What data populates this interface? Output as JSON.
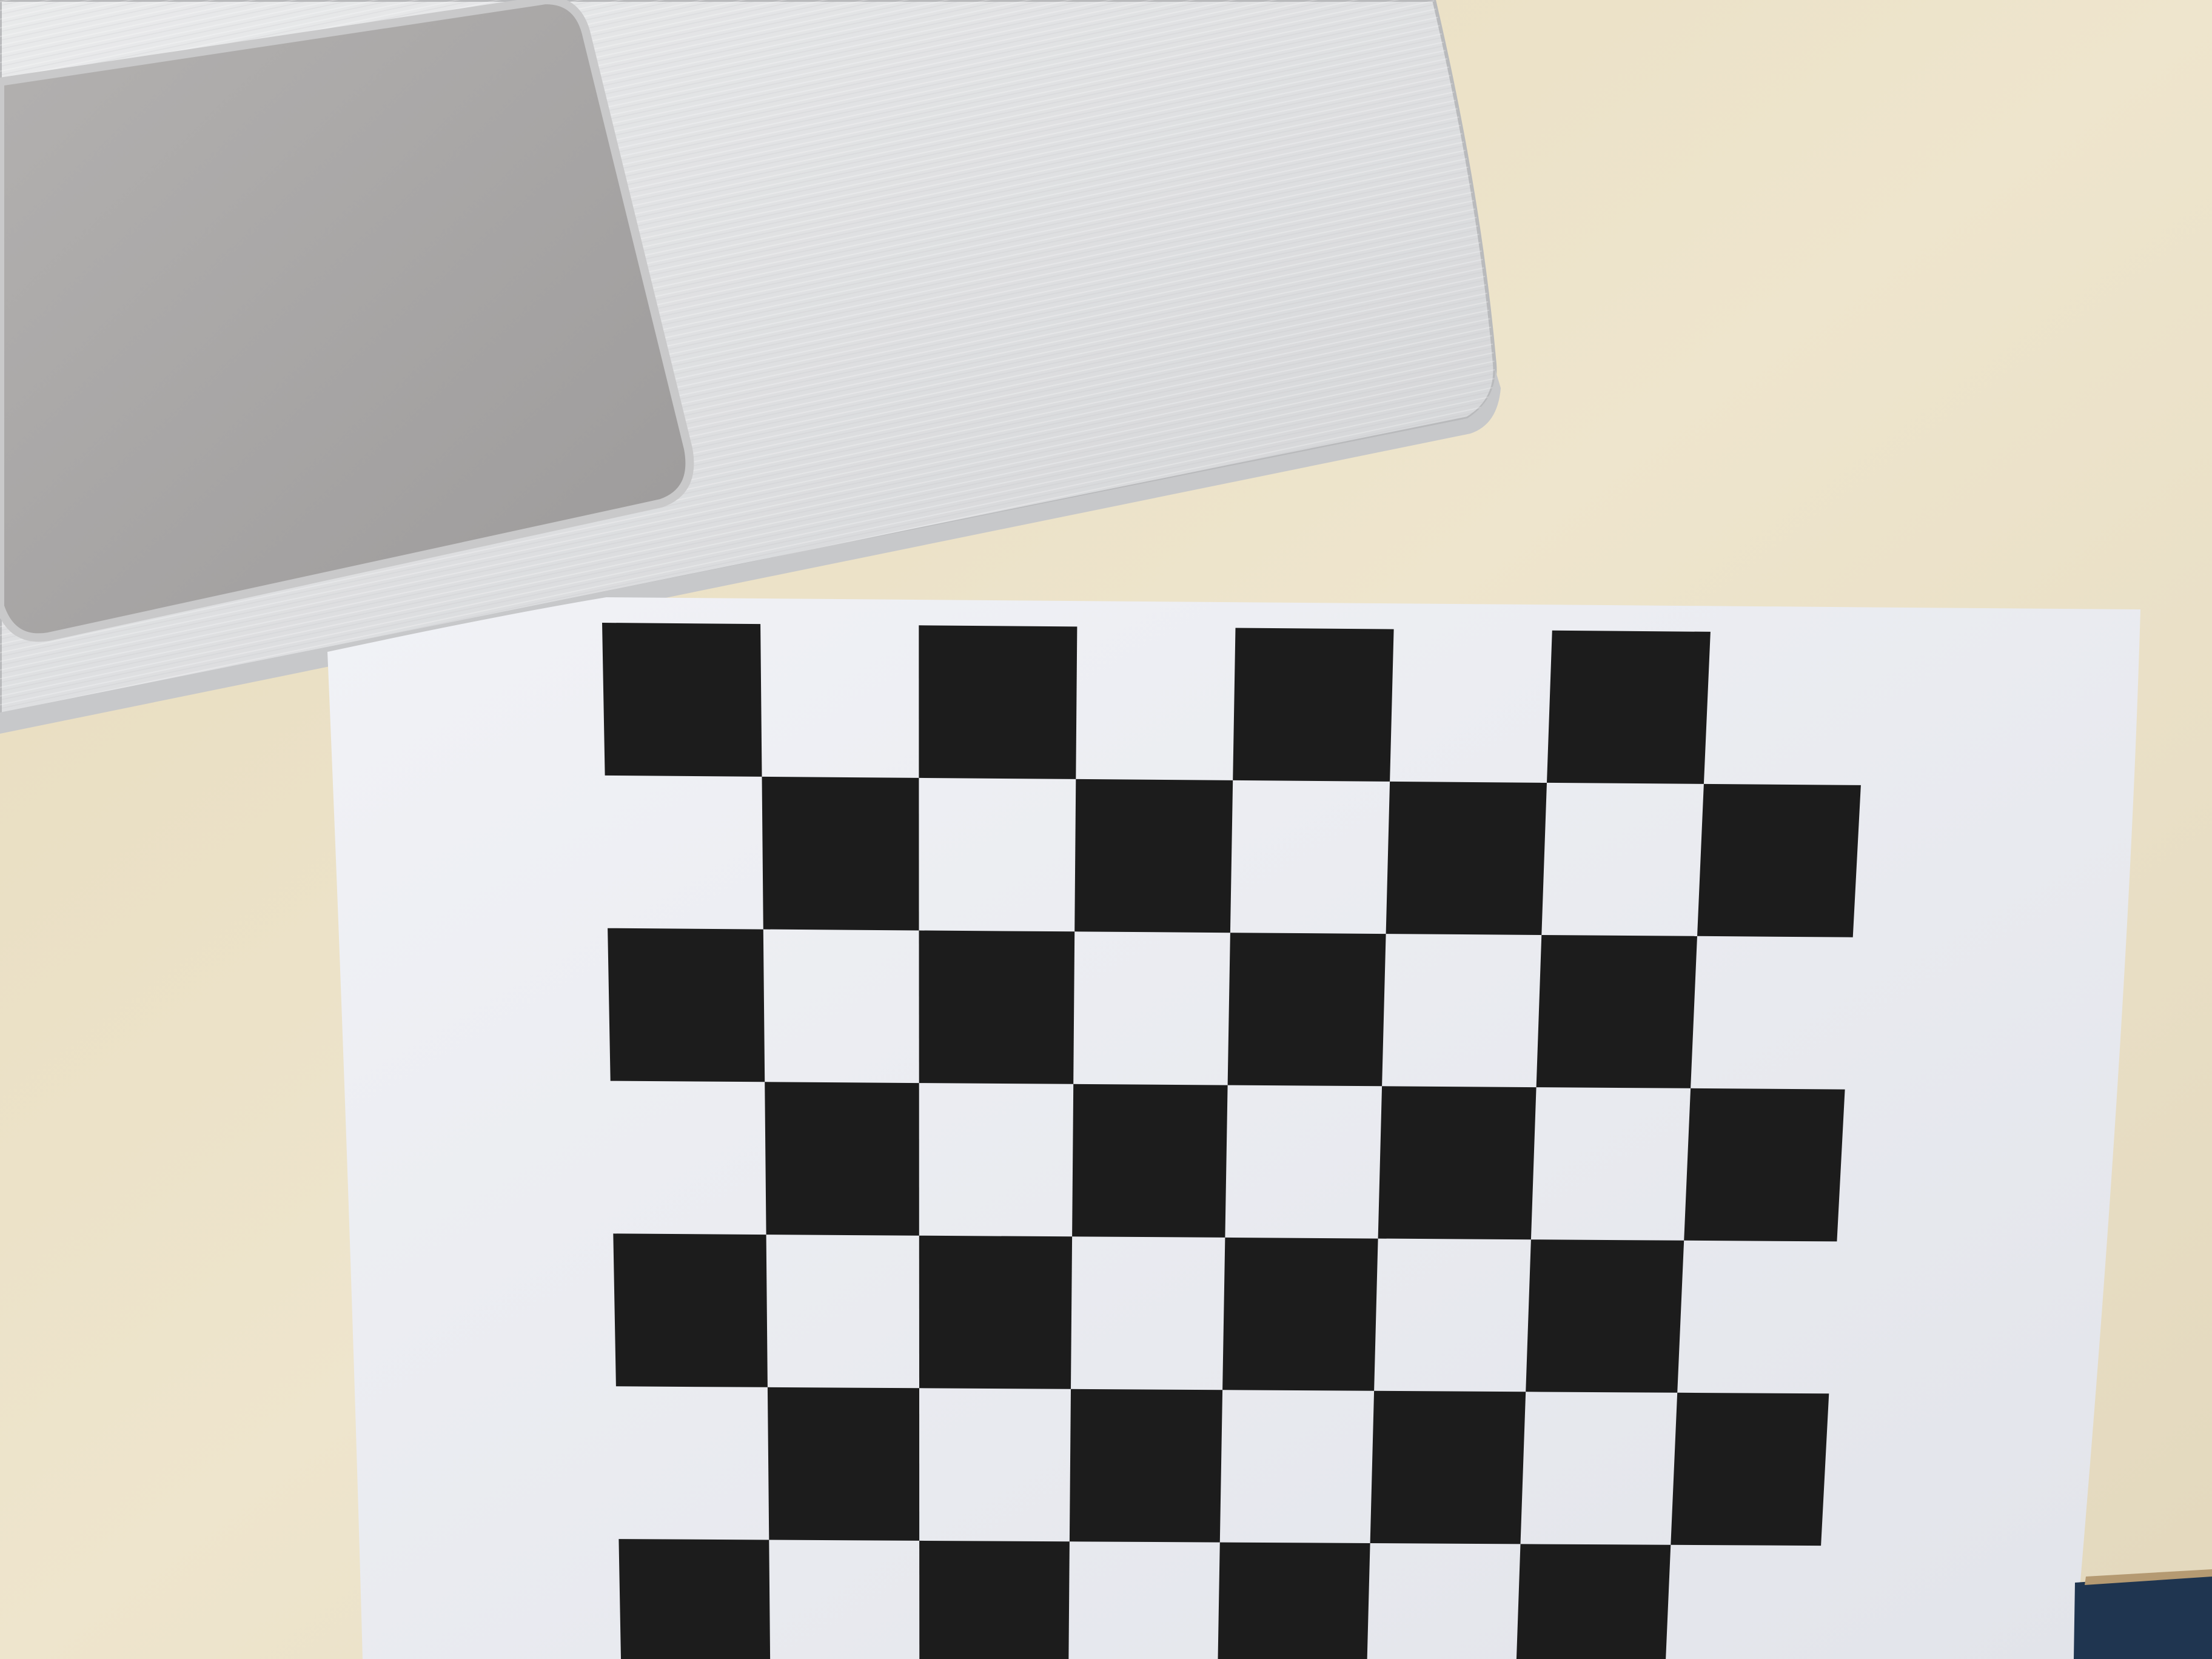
{
  "scene": {
    "objects": [
      "laptop-palmrest",
      "touchpad",
      "checkerboard-sheet",
      "fabric-corner"
    ]
  },
  "colors": {
    "table": "#ece2c8",
    "table_shade": "#d9cba8",
    "laptop_body": "#dedfe0",
    "laptop_highlight": "#f2f3f4",
    "laptop_edge": "#bfc0c2",
    "touchpad": "#a9a7a7",
    "touchpad_dark": "#8f8d8d",
    "paper": "#eef0f4",
    "paper_shade": "#dfe2e8",
    "square": "#1c1c1c",
    "fabric": "#1f3550"
  },
  "checkerboard": {
    "columns": 8,
    "rows": 7,
    "first_square_dark": true
  }
}
